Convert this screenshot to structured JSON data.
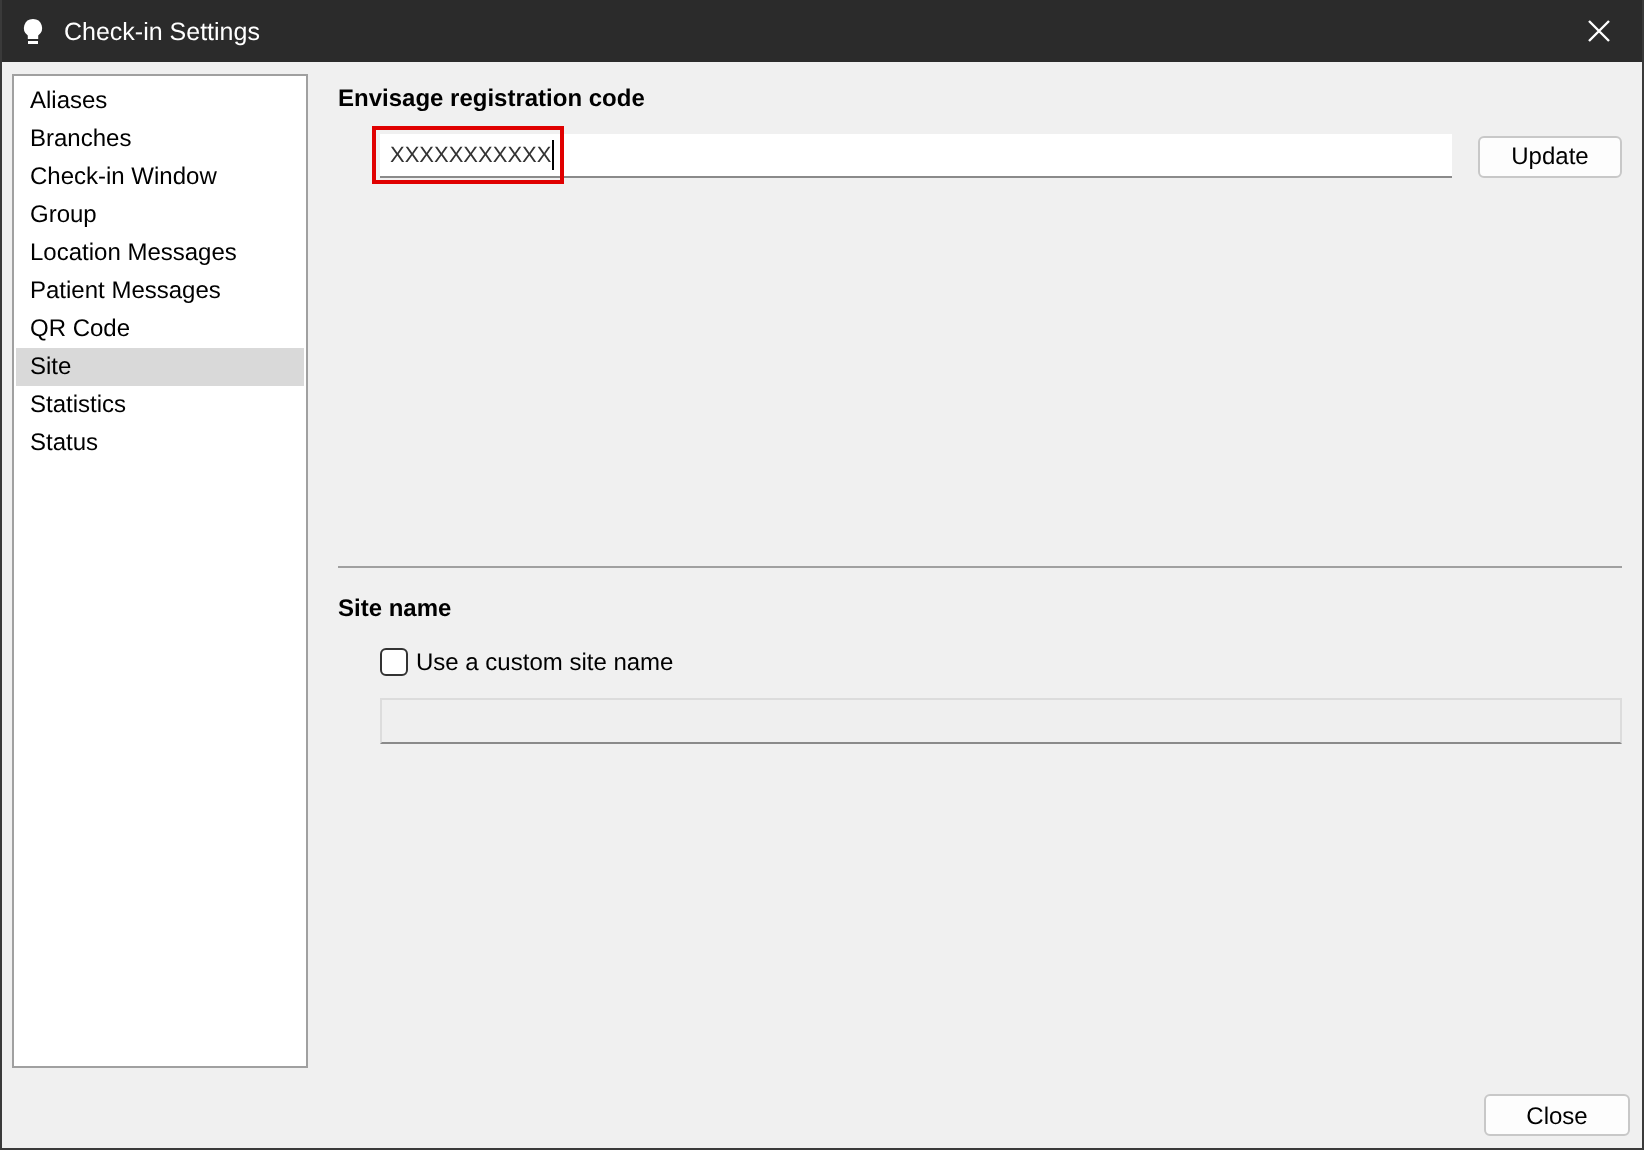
{
  "window": {
    "title": "Check-in Settings"
  },
  "sidebar": {
    "items": [
      {
        "label": "Aliases",
        "selected": false
      },
      {
        "label": "Branches",
        "selected": false
      },
      {
        "label": "Check-in Window",
        "selected": false
      },
      {
        "label": "Group",
        "selected": false
      },
      {
        "label": "Location Messages",
        "selected": false
      },
      {
        "label": "Patient Messages",
        "selected": false
      },
      {
        "label": "QR Code",
        "selected": false
      },
      {
        "label": "Site",
        "selected": true
      },
      {
        "label": "Statistics",
        "selected": false
      },
      {
        "label": "Status",
        "selected": false
      }
    ]
  },
  "registration": {
    "heading": "Envisage registration code",
    "value": "XXXXXXXXXXX",
    "button": "Update"
  },
  "site_name": {
    "heading": "Site name",
    "checkbox": {
      "label": "Use a custom site name",
      "checked": false
    },
    "field": {
      "disabled": true
    }
  },
  "buttons": [
    "Close"
  ]
}
